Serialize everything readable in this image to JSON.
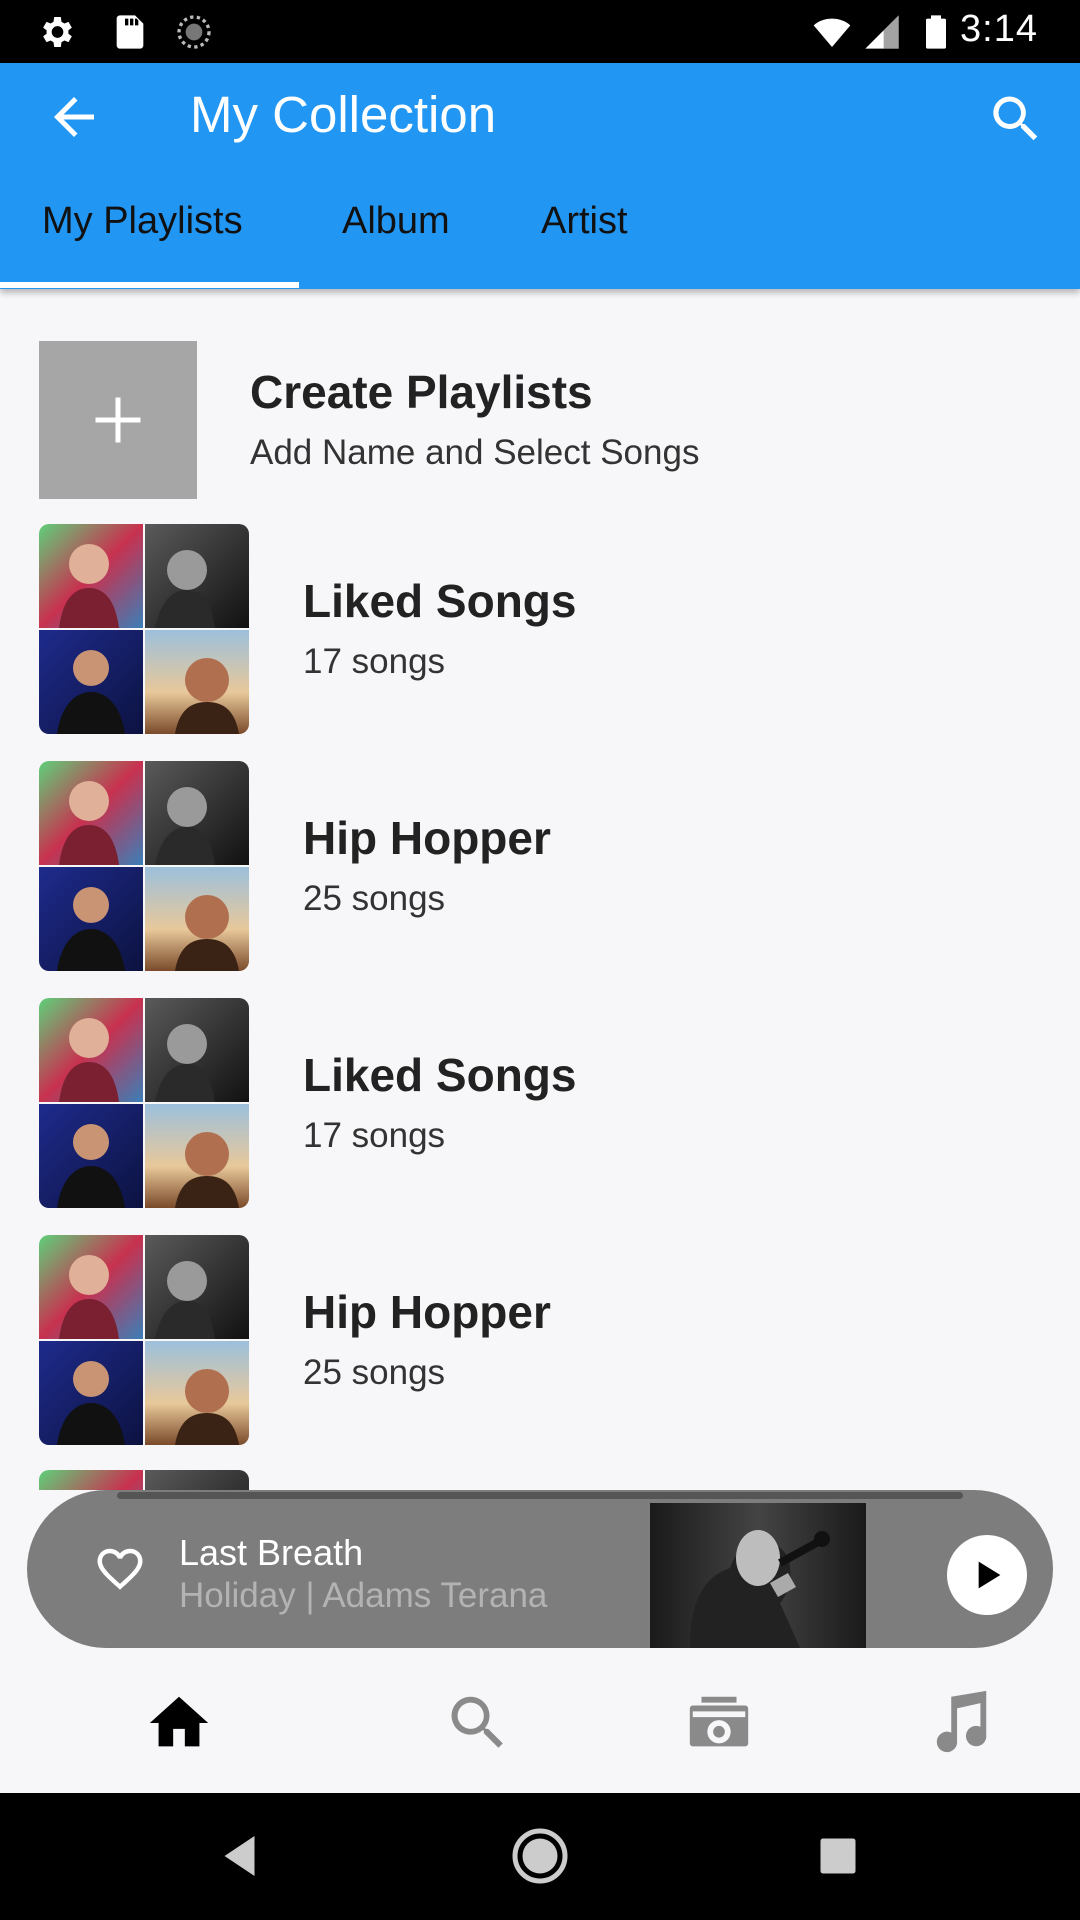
{
  "status_bar": {
    "time": "3:14",
    "left_icons": [
      "gear-icon",
      "sd-card-icon",
      "sync-icon"
    ],
    "right_icons": [
      "wifi-icon",
      "cell-signal-icon",
      "battery-icon"
    ]
  },
  "app_bar": {
    "title": "My Collection",
    "back_icon": "arrow-left-icon",
    "search_icon": "search-icon",
    "background": "#2196f3"
  },
  "tabs": [
    {
      "label": "My Playlists",
      "selected": true
    },
    {
      "label": "Album",
      "selected": false
    },
    {
      "label": "Artist",
      "selected": false
    }
  ],
  "create_playlist": {
    "title": "Create Playlists",
    "subtitle": "Add Name and Select Songs",
    "icon": "plus-icon"
  },
  "playlists": [
    {
      "title": "Liked Songs",
      "subtitle": "17 songs"
    },
    {
      "title": "Hip Hopper",
      "subtitle": "25 songs"
    },
    {
      "title": "Liked Songs",
      "subtitle": "17 songs"
    },
    {
      "title": "Hip Hopper",
      "subtitle": "25 songs"
    },
    {
      "title": "",
      "subtitle": ""
    }
  ],
  "mini_player": {
    "track_title": "Last Breath",
    "track_subtitle": "Holiday | Adams Terana",
    "heart_icon": "heart-outline-icon",
    "play_icon": "play-icon",
    "background": "#7d7d7d"
  },
  "bottom_nav": [
    {
      "icon": "home-icon",
      "active": true
    },
    {
      "icon": "search-icon",
      "active": false
    },
    {
      "icon": "radio-icon",
      "active": false
    },
    {
      "icon": "music-note-icon",
      "active": false
    }
  ],
  "system_nav": [
    "back-triangle-icon",
    "home-circle-icon",
    "recents-square-icon"
  ]
}
